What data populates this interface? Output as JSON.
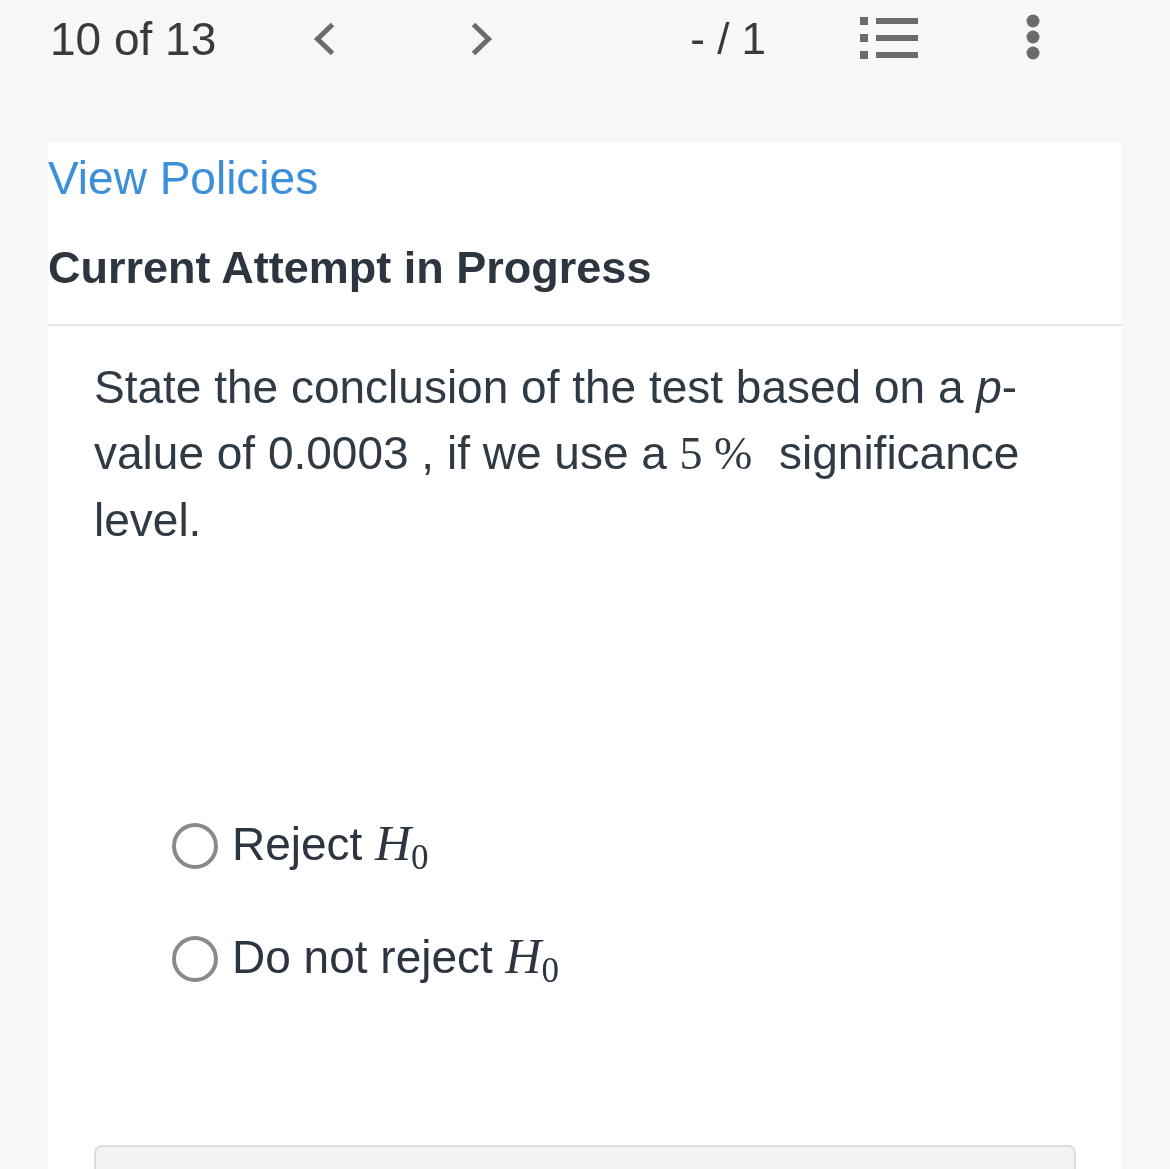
{
  "toolbar": {
    "position": "10 of 13",
    "score": "- / 1"
  },
  "policies_link": "View Policies",
  "heading": "Current Attempt in Progress",
  "question": [
    {
      "kind": "text",
      "text": "State the conclusion of the test based on a *p*-value of 0.0003 , if we use a "
    },
    {
      "kind": "math",
      "text": "5 %"
    },
    {
      "kind": "text",
      "text": " significance level."
    }
  ],
  "options": [
    {
      "label": "Reject",
      "symbol": "H",
      "subscript": "0",
      "selected": false
    },
    {
      "label": "Do not reject",
      "symbol": "H",
      "subscript": "0",
      "selected": false
    }
  ]
}
